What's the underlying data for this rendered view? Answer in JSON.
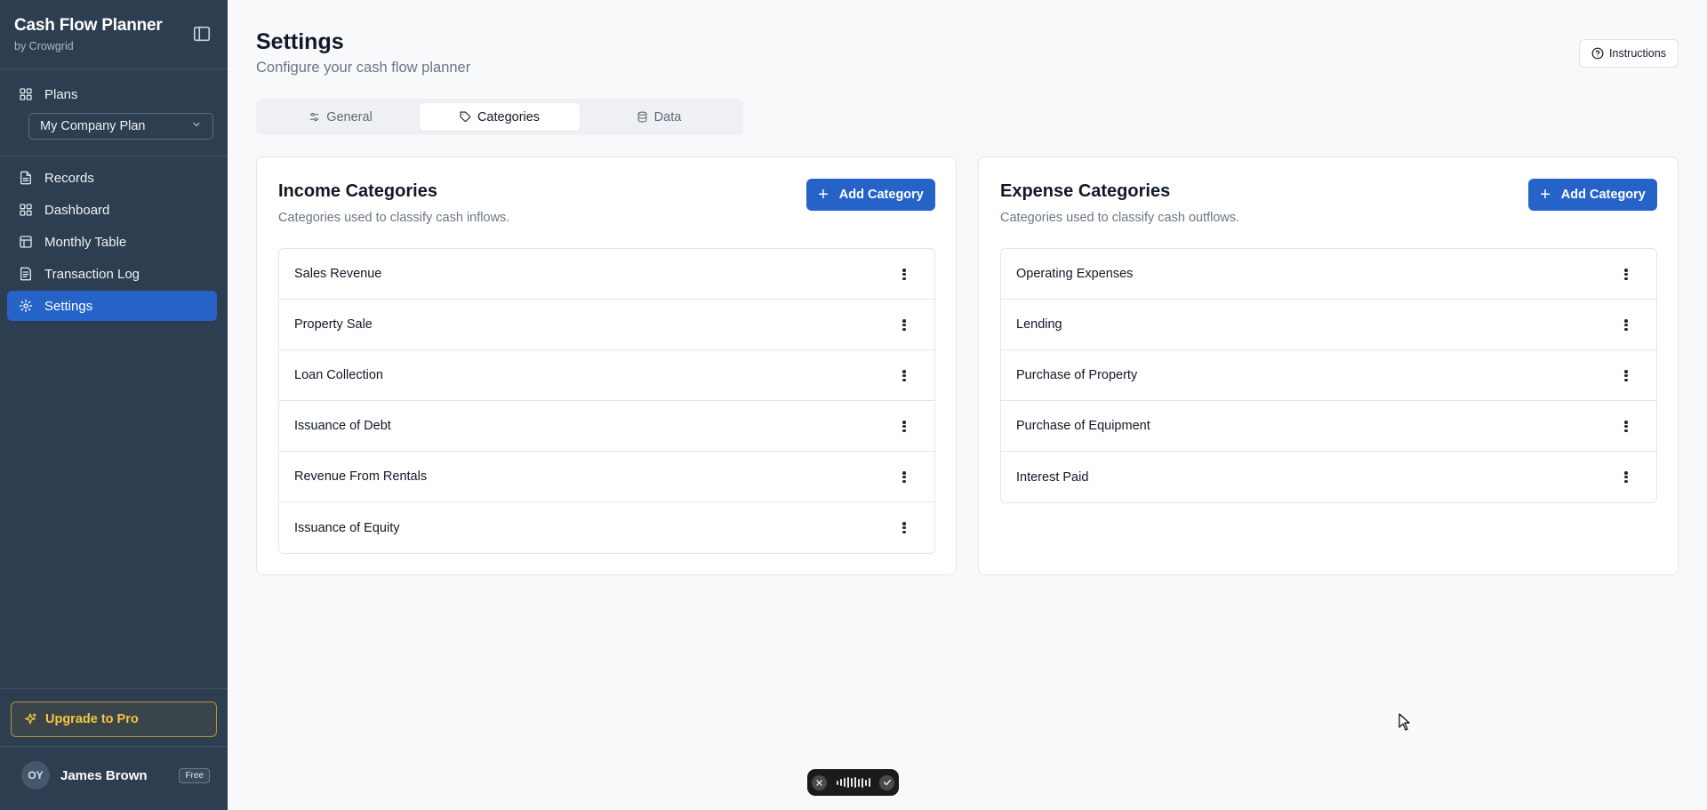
{
  "app": {
    "title": "Cash Flow Planner",
    "subtitle": "by Crowgrid"
  },
  "sidebar": {
    "plans_label": "Plans",
    "plan_selected": "My Company Plan",
    "items": [
      {
        "label": "Records",
        "icon": "file-text-icon"
      },
      {
        "label": "Dashboard",
        "icon": "layout-grid-icon"
      },
      {
        "label": "Monthly Table",
        "icon": "table-icon"
      },
      {
        "label": "Transaction Log",
        "icon": "receipt-icon"
      },
      {
        "label": "Settings",
        "icon": "gear-icon",
        "active": true
      }
    ],
    "upgrade_label": "Upgrade to Pro",
    "user": {
      "initials": "OY",
      "name": "James Brown",
      "plan": "Free"
    }
  },
  "header": {
    "title": "Settings",
    "subtitle": "Configure your cash flow planner",
    "instructions_label": "Instructions"
  },
  "tabs": [
    {
      "label": "General",
      "icon": "sliders-icon"
    },
    {
      "label": "Categories",
      "icon": "tag-icon",
      "active": true
    },
    {
      "label": "Data",
      "icon": "database-icon"
    }
  ],
  "income": {
    "title": "Income Categories",
    "subtitle": "Categories used to classify cash inflows.",
    "add_label": "Add Category",
    "items": [
      "Sales Revenue",
      "Property Sale",
      "Loan Collection",
      "Issuance of Debt",
      "Revenue From Rentals",
      "Issuance of Equity"
    ]
  },
  "expense": {
    "title": "Expense Categories",
    "subtitle": "Categories used to classify cash outflows.",
    "add_label": "Add Category",
    "items": [
      "Operating Expenses",
      "Lending",
      "Purchase of Property",
      "Purchase of Equipment",
      "Interest Paid"
    ]
  },
  "colors": {
    "sidebar_bg": "#2d3e50",
    "accent": "#2563c9",
    "upgrade": "#f5c542"
  }
}
